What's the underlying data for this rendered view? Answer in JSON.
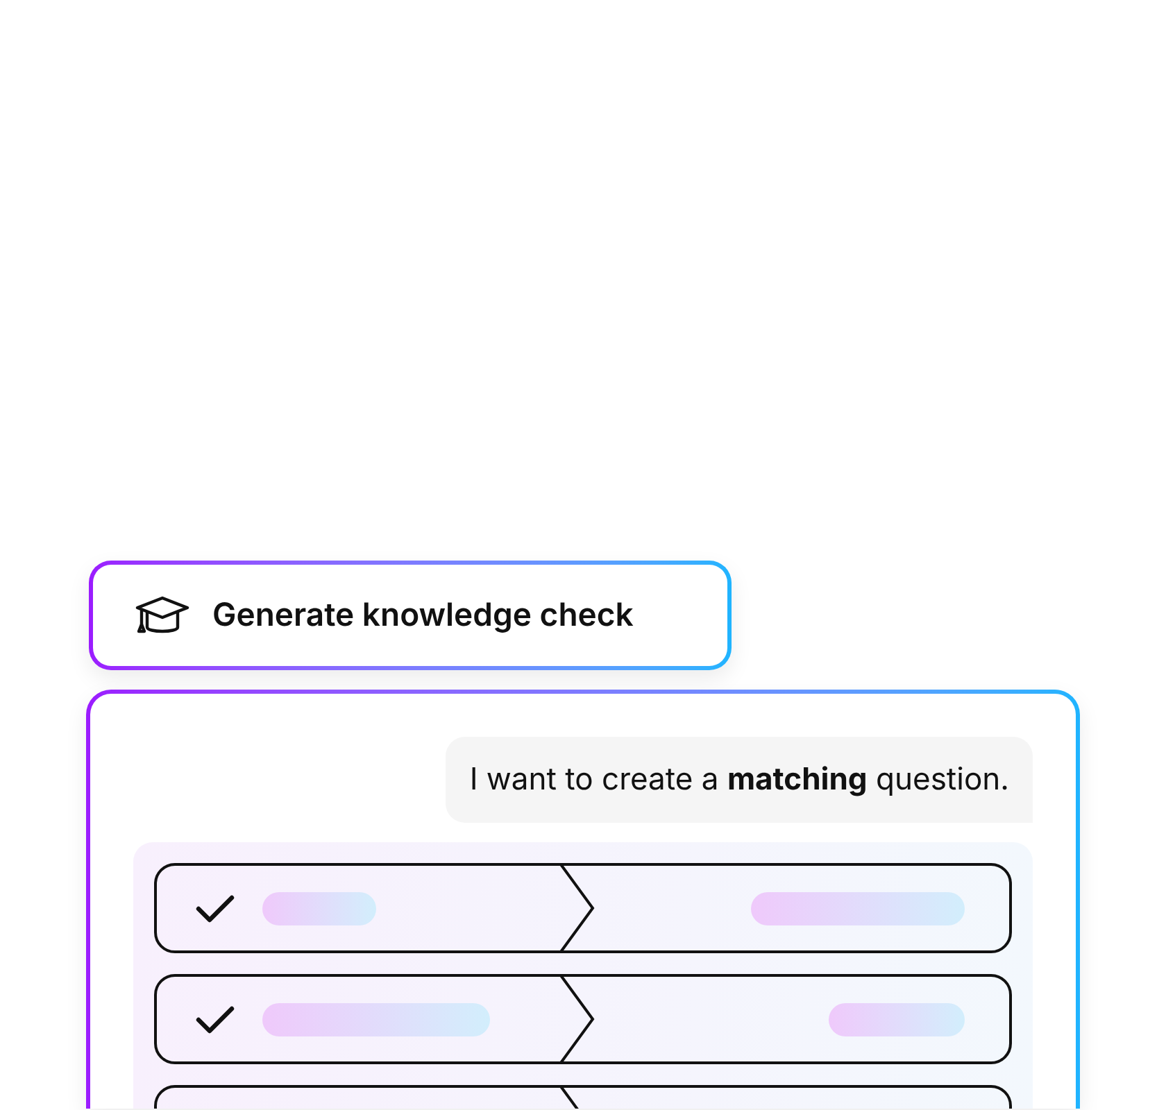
{
  "action_button": {
    "label": "Generate knowledge check"
  },
  "message": {
    "text": "I want to create a **matching** question."
  },
  "match_rows": [
    {
      "checked": true
    },
    {
      "checked": true
    },
    {}
  ]
}
